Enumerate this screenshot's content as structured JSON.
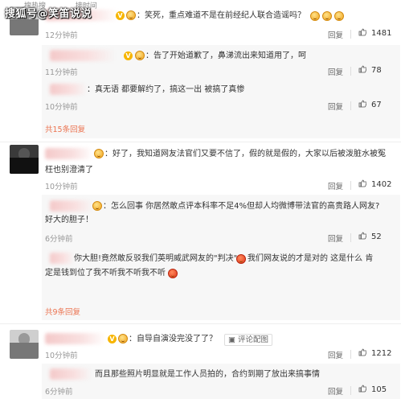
{
  "watermark": "搜狐号@笑笛说说",
  "header_fade": [
    "搜热搜",
    "接时间"
  ],
  "comments": [
    {
      "id": "c1",
      "text": "：笑死，重点难道不是在前经纪人联合造谣吗？",
      "time": "12分钟前",
      "reply": "回复",
      "likes": "1481",
      "more": "",
      "subs": [
        {
          "text": "：告了开始道歉了，鼻涕流出来知道用了，呵",
          "time": "11分钟前",
          "reply": "回复",
          "likes": "78"
        },
        {
          "text": "：真无语 都要解约了，搞这一出 被搞了真惨",
          "time": "10分钟前",
          "reply": "回复",
          "likes": "67"
        }
      ],
      "more_label": "共15条回复"
    },
    {
      "id": "c2",
      "text_line1": "：好了，我知道网友法官们又要不信了，假的就是假的，大家以后被泼脏水被冤",
      "text_line2": "枉也别澄清了",
      "time": "10分钟前",
      "reply": "回复",
      "likes": "1402",
      "subs": [
        {
          "text_line1": "：怎么回事 你居然敢点评本科率不足4%但却人均微博带法官的高贵路人网友?",
          "text_line2": "好大的胆子！",
          "time": "6分钟前",
          "reply": "回复",
          "likes": "52"
        },
        {
          "text_line1": "你大胆!竟然敢反驳我们英明威武网友的\"判决\"",
          "text_line1b": "我们网友说的才是对的 这是什么 肯",
          "text_line2": "定是钱到位了我不听我不听我不听",
          "time": "",
          "reply": "",
          "likes": ""
        }
      ],
      "more_label": "共9条回复"
    },
    {
      "id": "c3",
      "text": "：自导自演没完没了了？",
      "time": "10分钟前",
      "reply": "回复",
      "comment_btn": "评论配图",
      "likes": "1212",
      "subs": [
        {
          "text": "而且那些照片明显就是工作人员拍的，合约到期了放出来搞事情",
          "time": "6分钟前",
          "reply": "回复",
          "likes": "105"
        }
      ]
    }
  ],
  "colors": {
    "accent": "#eb7350",
    "vip": "#f7b500",
    "bg_sub": "#f7f7f7"
  }
}
